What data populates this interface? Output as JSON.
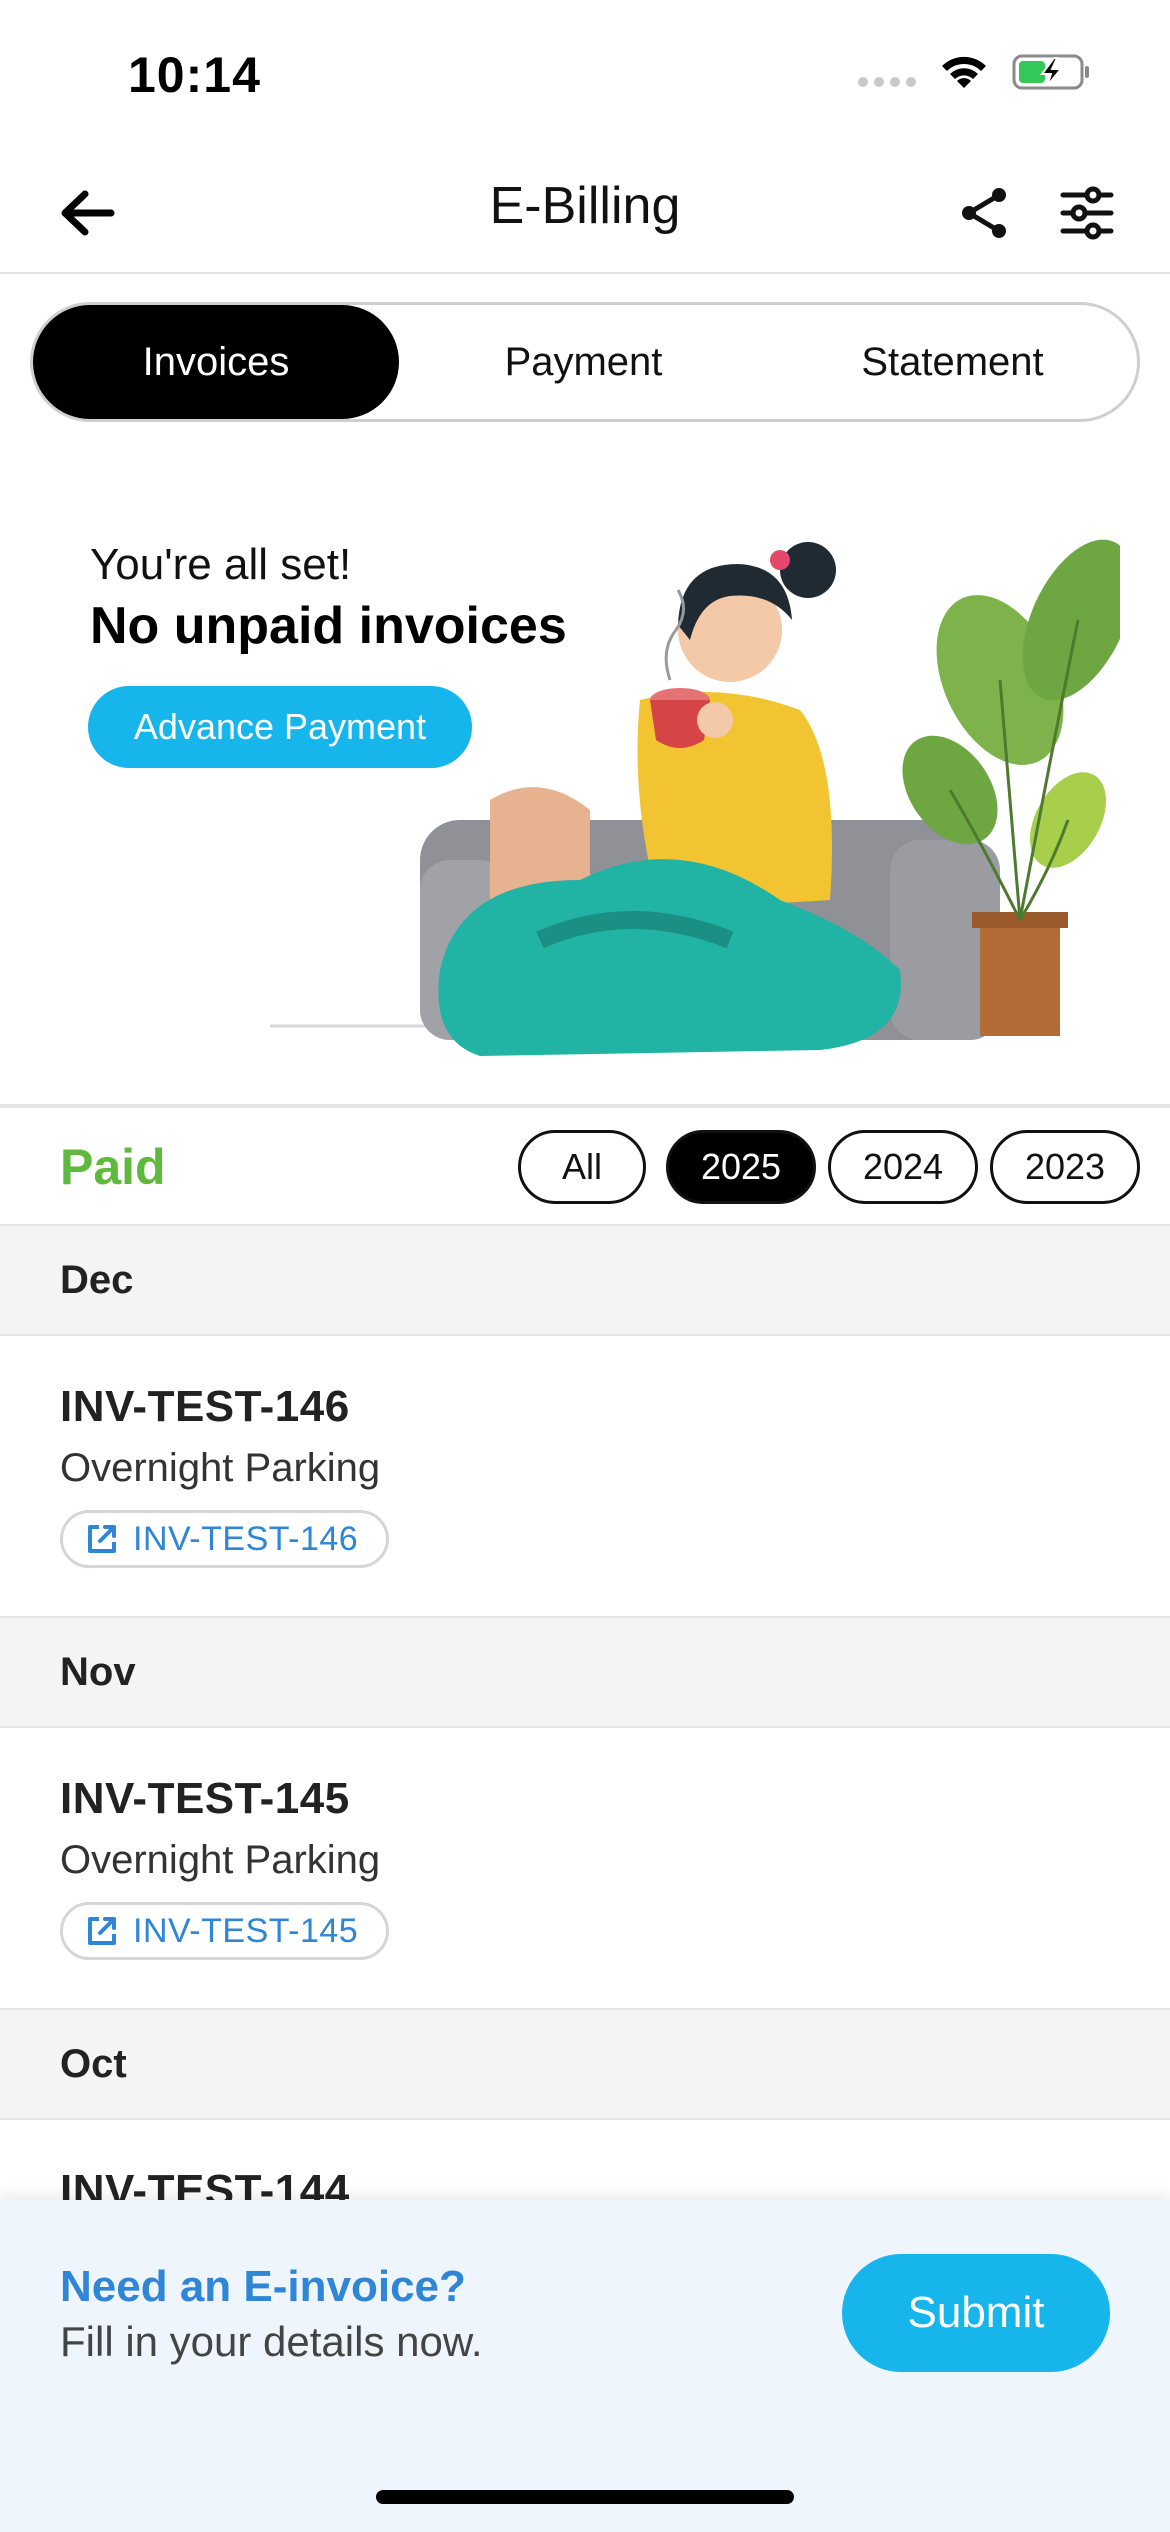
{
  "status_bar": {
    "time": "10:14"
  },
  "header": {
    "title": "E-Billing"
  },
  "tabs": [
    {
      "label": "Invoices",
      "active": true
    },
    {
      "label": "Payment",
      "active": false
    },
    {
      "label": "Statement",
      "active": false
    }
  ],
  "hero": {
    "pre_title": "You're all set!",
    "title": "No unpaid invoices",
    "button_label": "Advance Payment"
  },
  "paid_section": {
    "label": "Paid",
    "filters": [
      {
        "label": "All",
        "active": false
      },
      {
        "label": "2025",
        "active": true
      },
      {
        "label": "2024",
        "active": false
      },
      {
        "label": "2023",
        "active": false
      }
    ]
  },
  "invoice_groups": [
    {
      "month": "Dec",
      "invoices": [
        {
          "number": "INV-TEST-146",
          "description": "Overnight Parking",
          "link_label": "INV-TEST-146"
        }
      ]
    },
    {
      "month": "Nov",
      "invoices": [
        {
          "number": "INV-TEST-145",
          "description": "Overnight Parking",
          "link_label": "INV-TEST-145"
        }
      ]
    },
    {
      "month": "Oct",
      "invoices": [
        {
          "number": "INV-TEST-144",
          "description": "",
          "link_label": ""
        }
      ]
    }
  ],
  "einvoice": {
    "title": "Need an E-invoice?",
    "subtitle": "Fill in your details now.",
    "button_label": "Submit"
  },
  "colors": {
    "accent_blue": "#16b6ec",
    "paid_green": "#5fb93c",
    "link_blue": "#2f85d6"
  }
}
